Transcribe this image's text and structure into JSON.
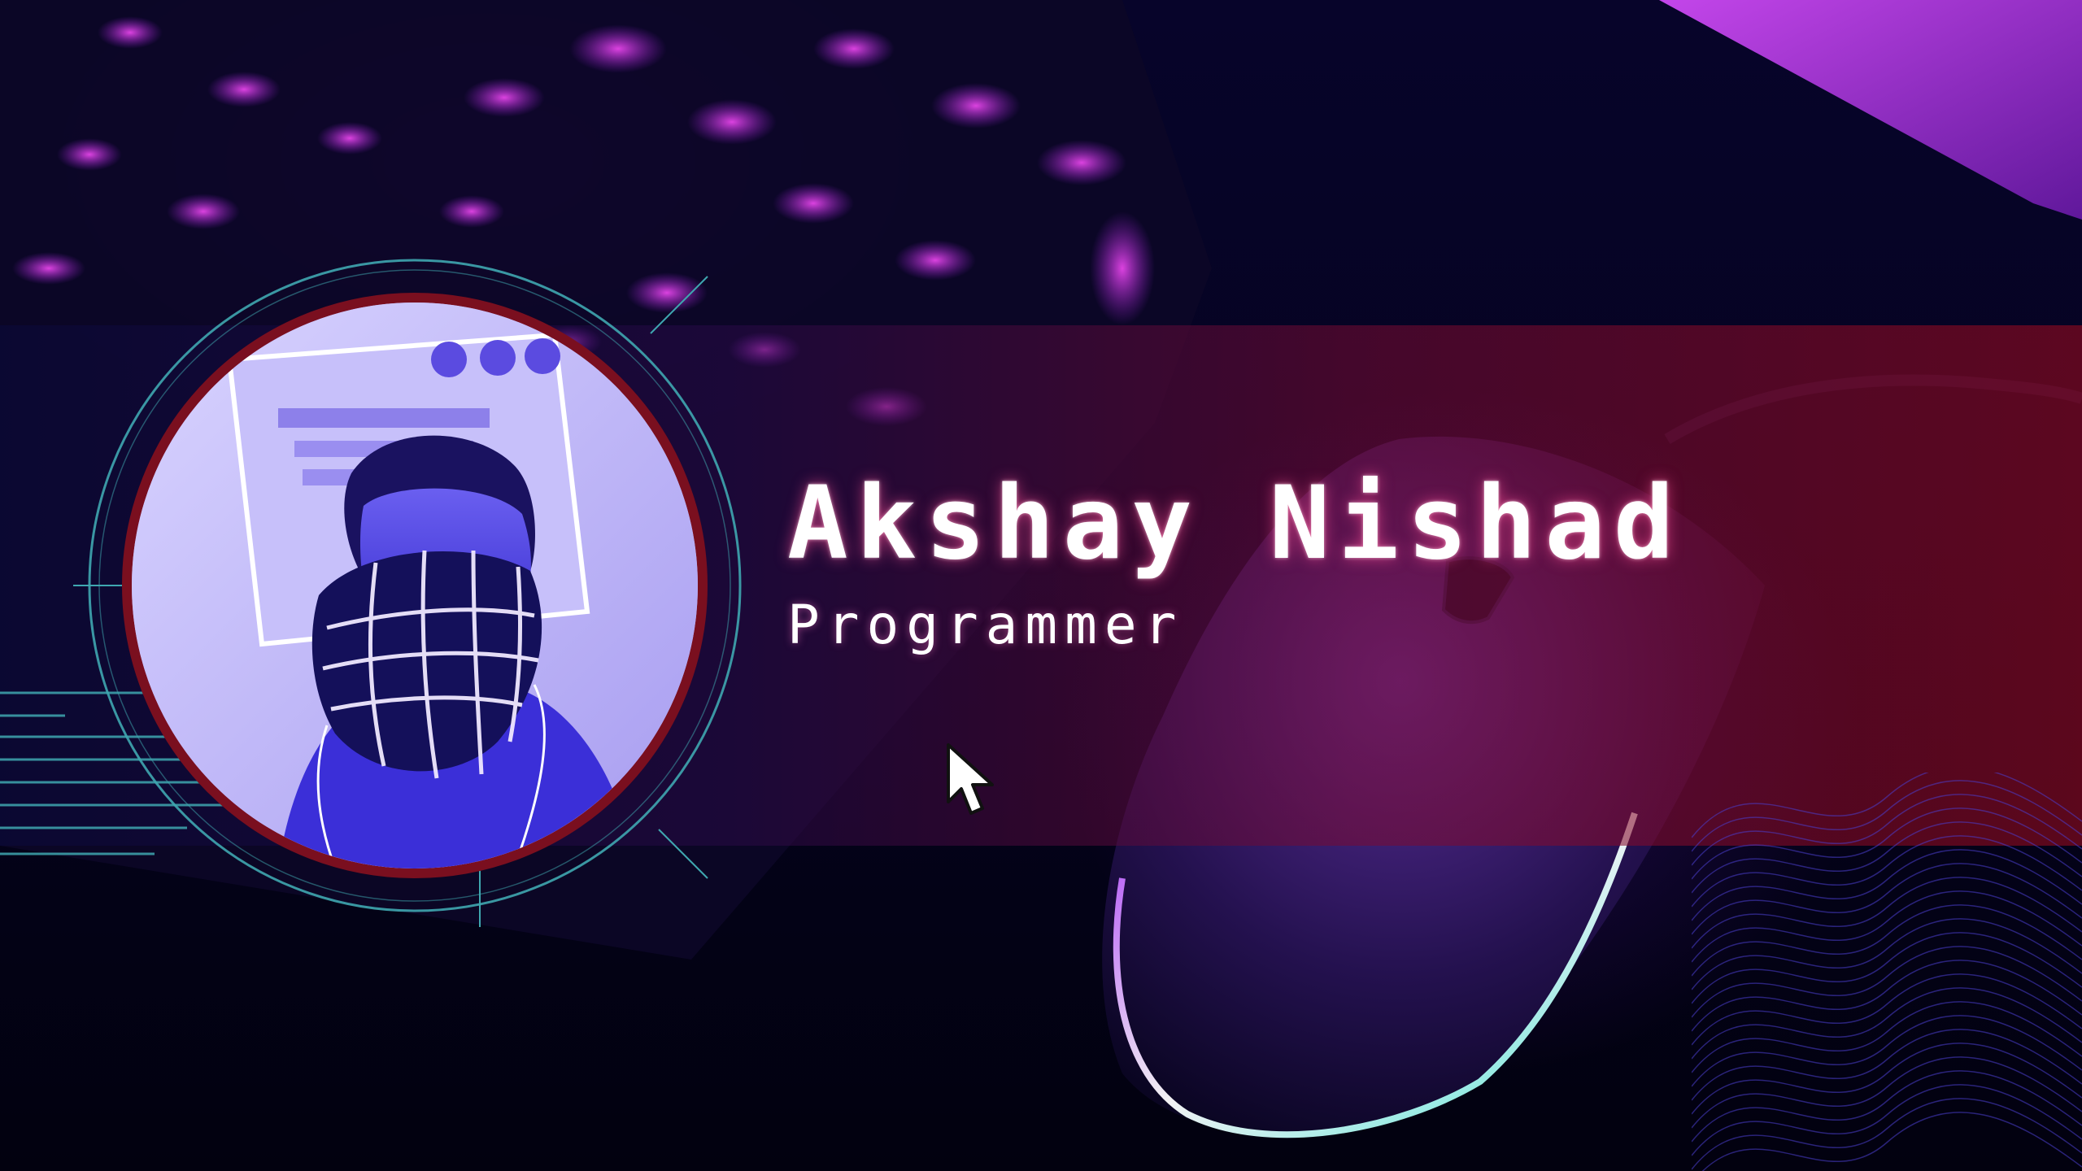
{
  "profile": {
    "name": "Akshay Nishad",
    "role": "Programmer"
  },
  "colors": {
    "band_left": "#0a0a3c",
    "band_right": "#960a1e",
    "accent_pink": "#e23cff",
    "ring_teal": "#3fa7b0",
    "avatar_border": "#7a0f1f",
    "avatar_tint": "#5a4be6"
  },
  "icons": {
    "cursor": "pointer-cursor-icon"
  }
}
